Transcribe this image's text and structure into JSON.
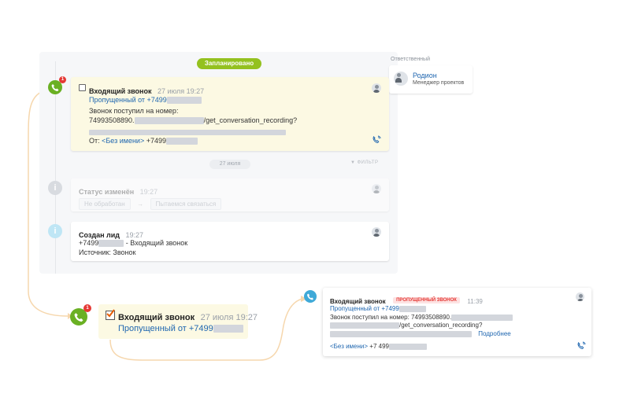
{
  "timeline": {
    "planned_label": "Запланировано",
    "date_label": "27 июля",
    "filter_label": "ФИЛЬТР"
  },
  "responsible": {
    "header": "Ответственный",
    "name": "Родион",
    "role": "Менеджер проектов"
  },
  "call_card": {
    "badge": "1",
    "title": "Входящий звонок",
    "time": "27 июля 19:27",
    "missed": "Пропущенный от +7499",
    "line1": "Звонок поступил на номер:",
    "line2_start": "74993508890.",
    "line2_end": "/get_conversation_recording?",
    "from_label": "От:",
    "from_name": "<Без имени>",
    "from_phone": "+7499"
  },
  "status_card": {
    "title": "Статус изменён",
    "time": "19:27",
    "from_status": "Не обработан",
    "arrow": "→",
    "to_status": "Пытаемся связаться"
  },
  "lead_card": {
    "title": "Создан лид",
    "time": "19:27",
    "phone": "+7499",
    "phone_suffix": "- Входящий звонок",
    "source": "Источник: Звонок"
  },
  "zoom_card": {
    "badge": "1",
    "title": "Входящий звонок",
    "time": "27 июля 19:27",
    "missed": "Пропущенный от +7499"
  },
  "detail_card": {
    "title": "Входящий звонок",
    "tag": "ПРОПУЩЕННЫЙ ЗВОНОК",
    "time": "11:39",
    "missed": "Пропущенный от +7499",
    "line1": "Звонок поступил на номер: 74993508890.",
    "line2": "/get_conversation_recording?",
    "more": "Подробнее",
    "from_name": "<Без имени>",
    "from_phone": "+7 499"
  },
  "colors": {
    "green": "#6ab023",
    "planned_green": "#94c11f",
    "link_blue": "#2067b0",
    "badge_red": "#e53935",
    "card_yellow": "#fcf9e3",
    "connector_orange": "#f6d7ad"
  }
}
